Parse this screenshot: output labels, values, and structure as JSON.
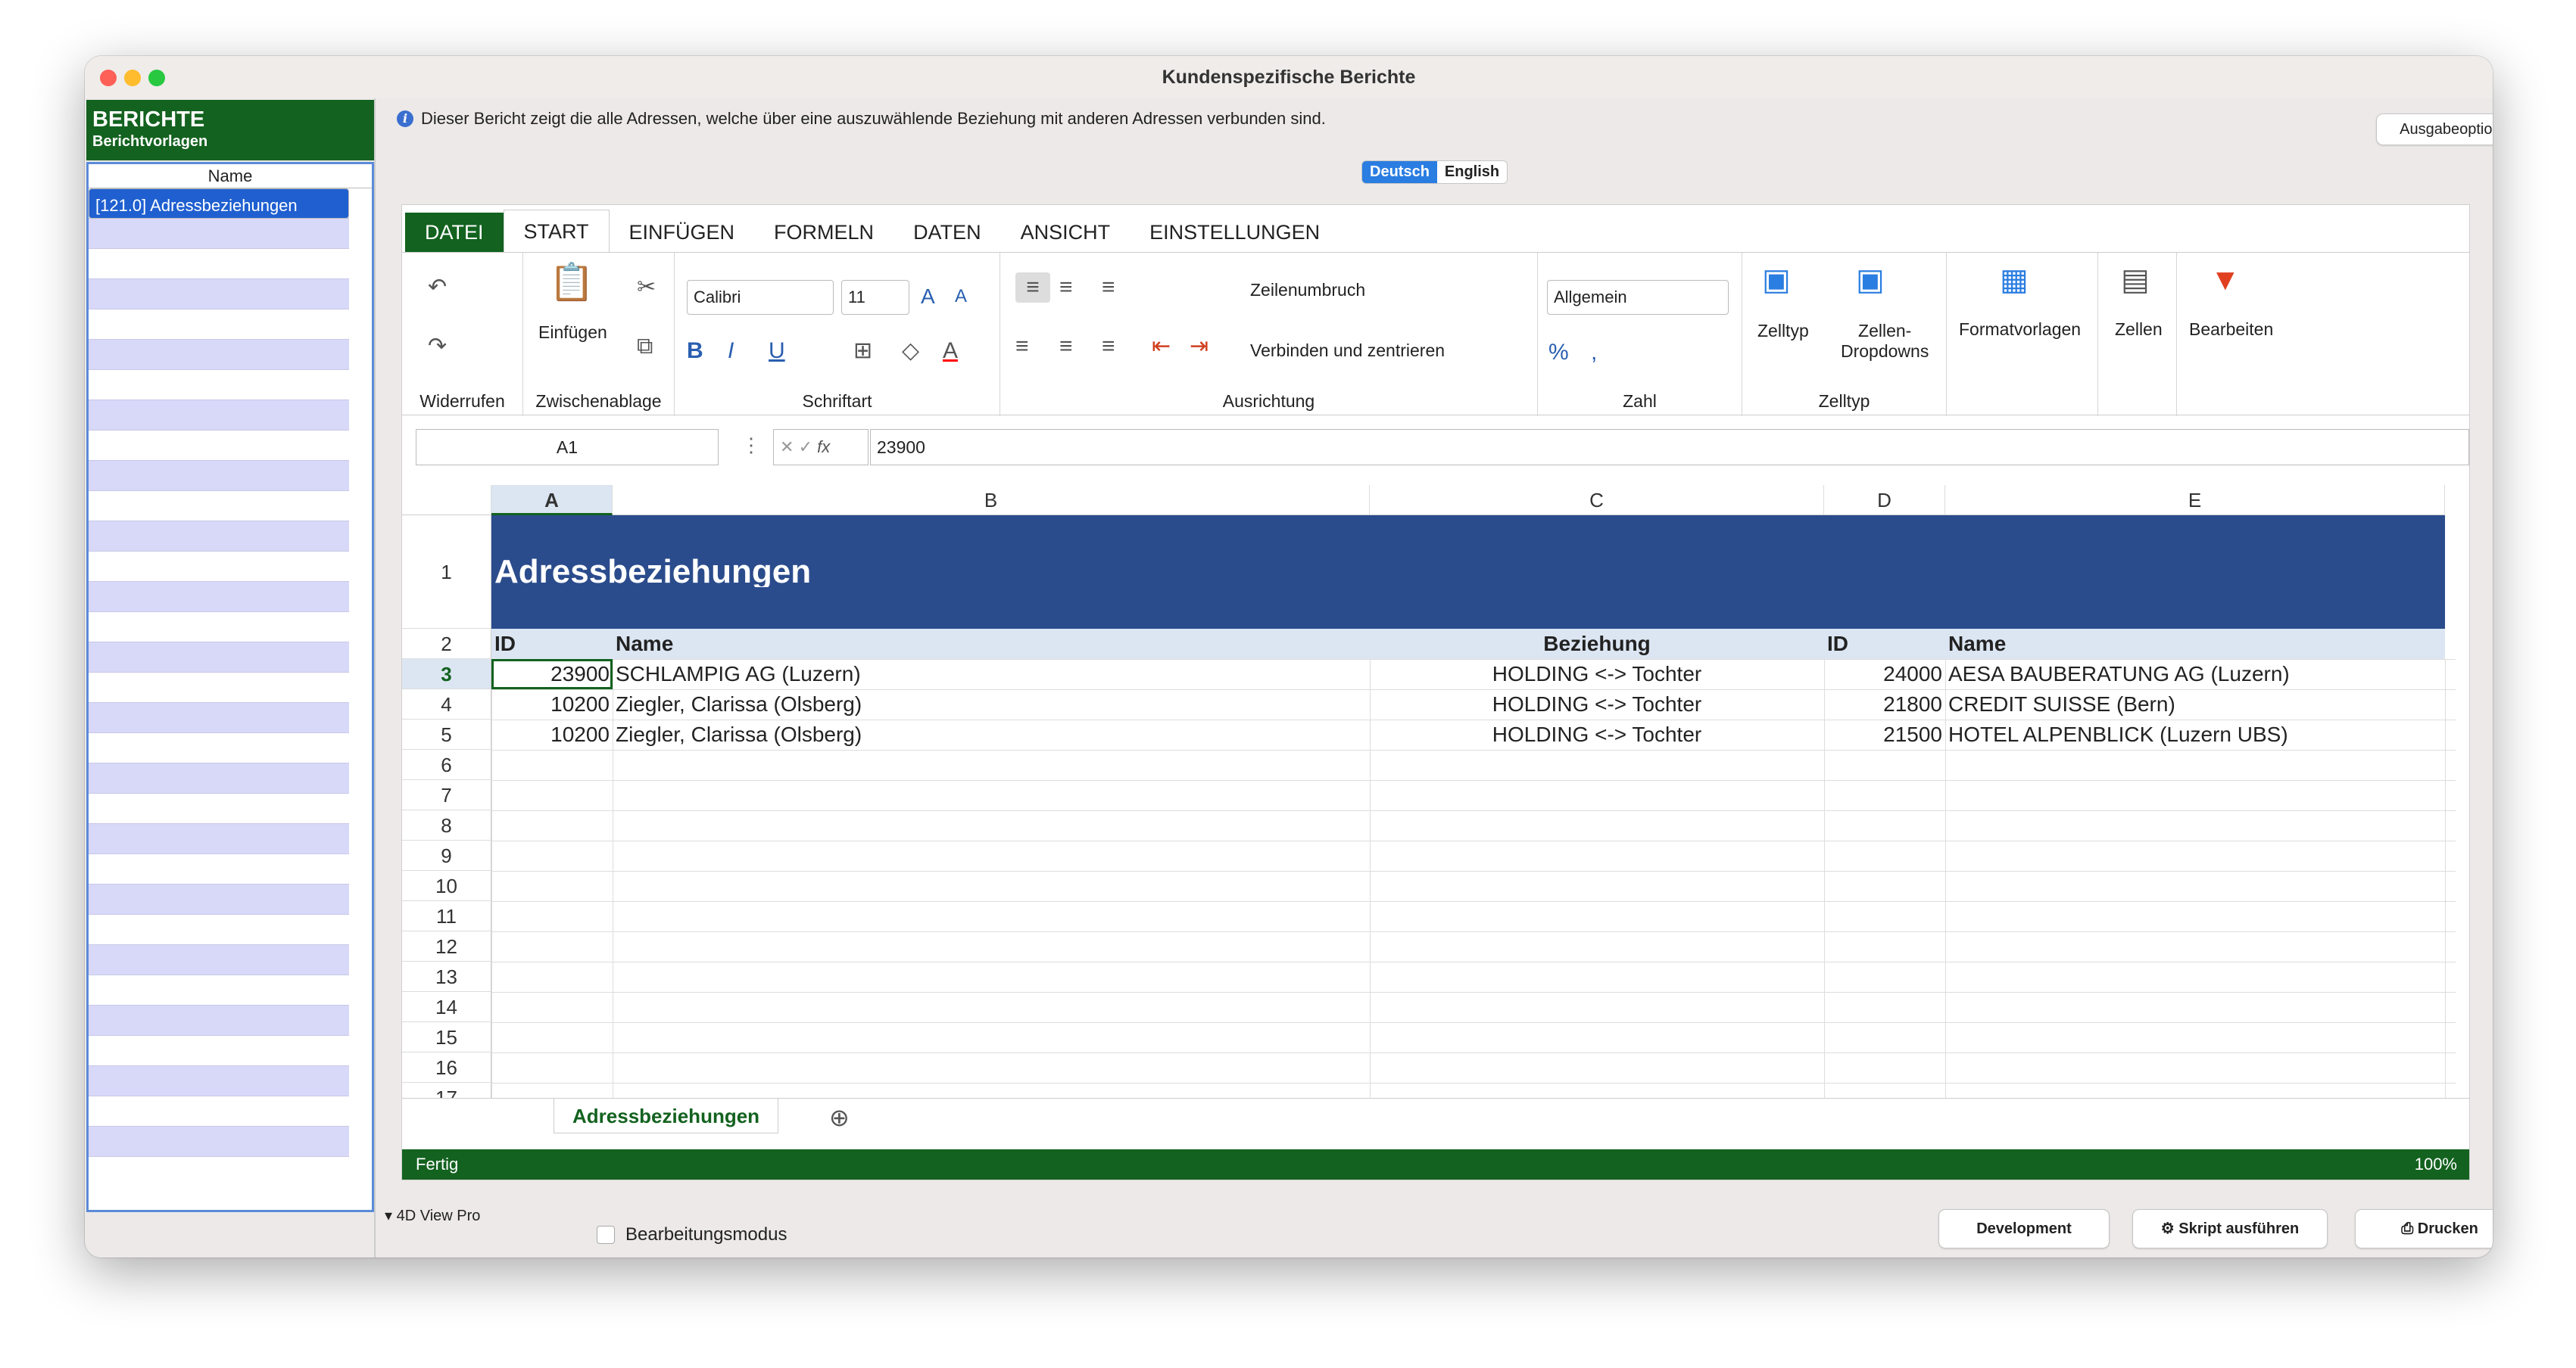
{
  "window": {
    "title": "Kundenspezifische Berichte"
  },
  "sidebar": {
    "title": "BERICHTE",
    "subtitle": "Berichtvorlagen",
    "column": "Name",
    "items": [
      "[121.0] Adressbeziehungen"
    ]
  },
  "info": {
    "text": "Dieser Bericht zeigt die alle Adressen, welche über eine auszuwählende Beziehung mit anderen Adressen verbunden sind.",
    "options_button": "Ausgabeoptionen"
  },
  "language": {
    "options": [
      "Deutsch",
      "English"
    ],
    "selected": "Deutsch"
  },
  "ribbon": {
    "tabs": [
      "DATEI",
      "START",
      "EINFÜGEN",
      "FORMELN",
      "DATEN",
      "ANSICHT",
      "EINSTELLUNGEN"
    ],
    "active_tab": "START",
    "groups": {
      "undo": "Widerrufen",
      "clipboard": "Zwischenablage",
      "paste": "Einfügen",
      "font": "Schriftart",
      "font_name": "Calibri",
      "font_size": "11",
      "alignment": "Ausrichtung",
      "wrap": "Zeilenumbruch",
      "merge": "Verbinden und zentrieren",
      "number": "Zahl",
      "number_format": "Allgemein",
      "celltype": "Zelltyp",
      "celltype_btn": "Zelltyp",
      "dropdowns_btn1": "Zellen-",
      "dropdowns_btn2": "Dropdowns",
      "styles": "Formatvorlagen",
      "cells": "Zellen",
      "edit": "Bearbeiten"
    }
  },
  "formula": {
    "cell": "A1",
    "value": "23900"
  },
  "columns": [
    "A",
    "B",
    "C",
    "D",
    "E"
  ],
  "rows": [
    "1",
    "2",
    "3",
    "4",
    "5",
    "6",
    "7",
    "8",
    "9",
    "10",
    "11",
    "12",
    "13",
    "14",
    "15",
    "16",
    "17"
  ],
  "sheet": {
    "title": "Adressbeziehungen",
    "headers": {
      "id1": "ID",
      "name1": "Name",
      "rel": "Beziehung",
      "id2": "ID",
      "name2": "Name"
    },
    "data": [
      {
        "id1": "23900",
        "name1": "SCHLAMPIG AG (Luzern)",
        "rel": "HOLDING <-> Tochter",
        "id2": "24000",
        "name2": "AESA BAUBERATUNG AG (Luzern)"
      },
      {
        "id1": "10200",
        "name1": "Ziegler, Clarissa (Olsberg)",
        "rel": "HOLDING <-> Tochter",
        "id2": "21800",
        "name2": "CREDIT SUISSE (Bern)"
      },
      {
        "id1": "10200",
        "name1": "Ziegler, Clarissa (Olsberg)",
        "rel": "HOLDING <-> Tochter",
        "id2": "21500",
        "name2": "HOTEL ALPENBLICK (Luzern UBS)"
      }
    ],
    "tab": "Adressbeziehungen"
  },
  "status": {
    "text": "Fertig",
    "zoom": "100%"
  },
  "bottom": {
    "view": "4D View Pro",
    "edit_mode": "Bearbeitungsmodus",
    "dev": "Development",
    "script": "Skript ausführen",
    "print": "Drucken"
  },
  "colors": {
    "green": "#13621f",
    "header_blue": "#2b4c8c",
    "subheader": "#dce6f2"
  }
}
